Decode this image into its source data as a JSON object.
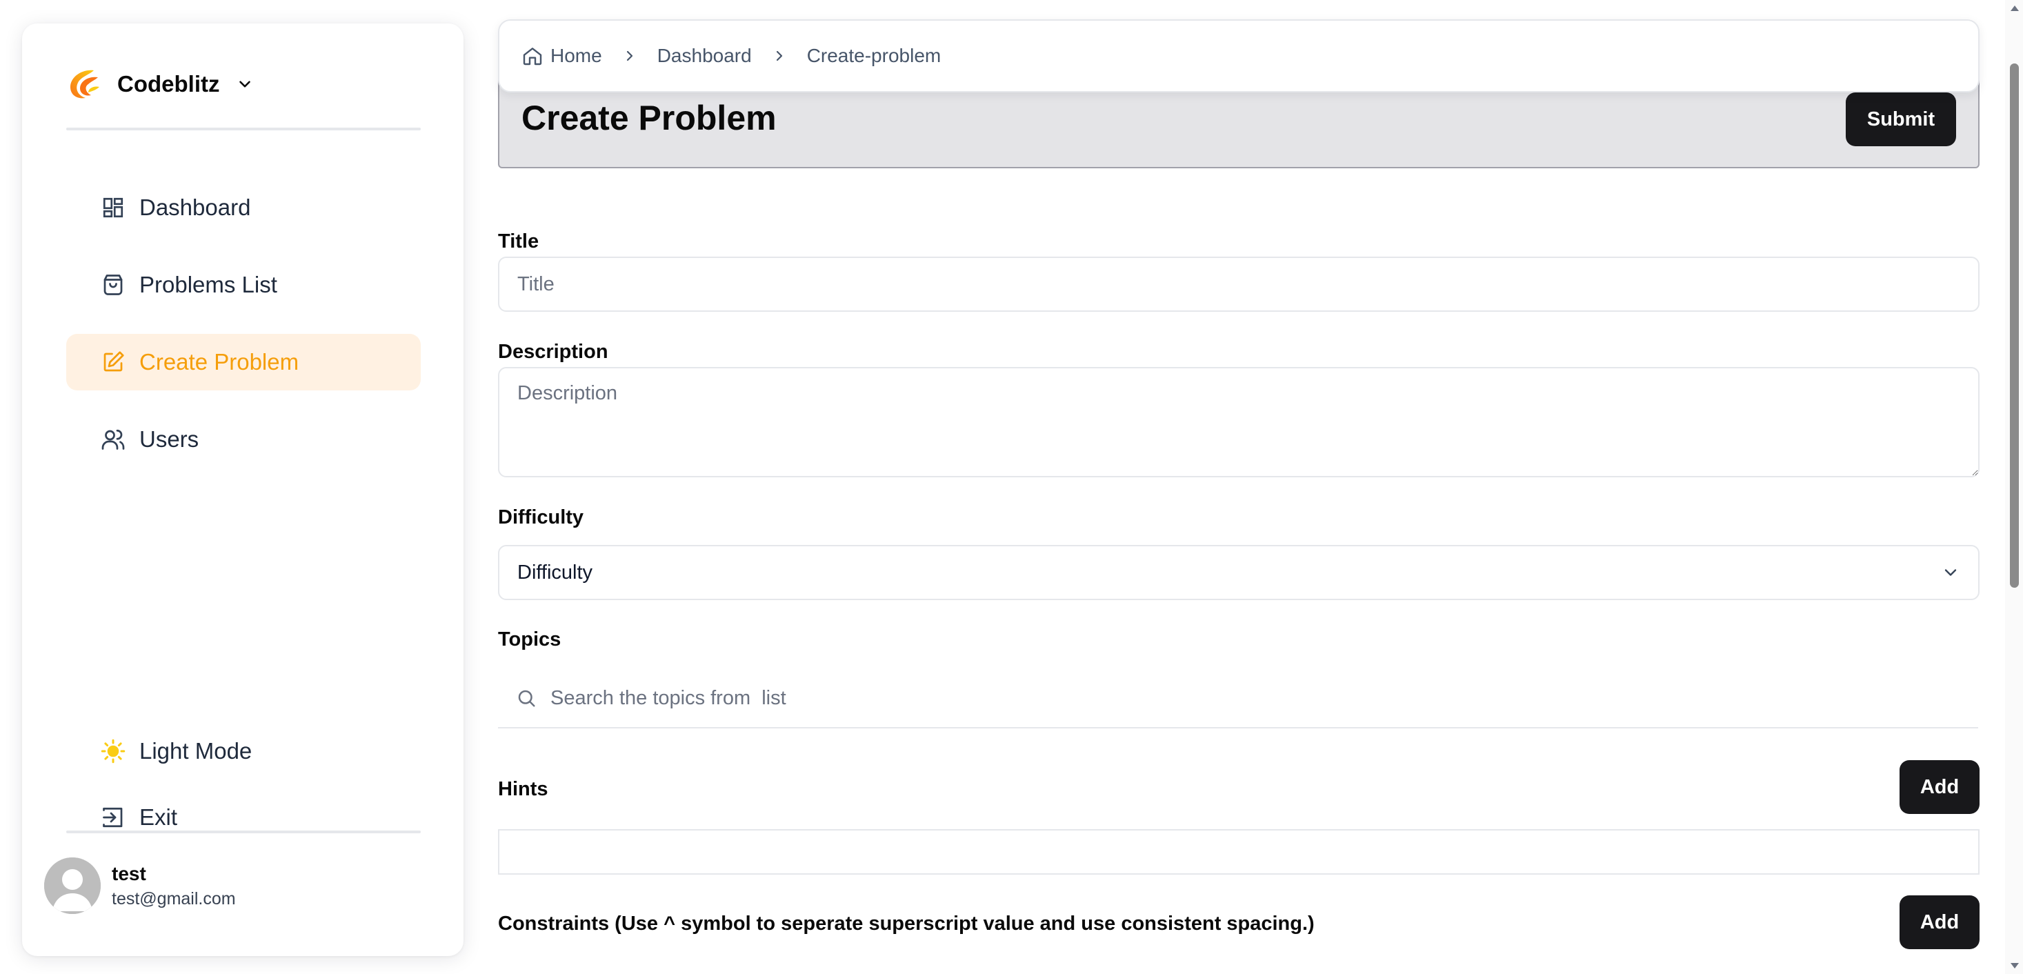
{
  "brand": {
    "name": "Codeblitz",
    "logo_colors": [
      "#f97316",
      "#facc15"
    ]
  },
  "sidebar": {
    "items": [
      {
        "label": "Dashboard",
        "icon": "dashboard-icon"
      },
      {
        "label": "Problems List",
        "icon": "shopping-bag-icon"
      },
      {
        "label": "Create Problem",
        "icon": "edit-square-icon",
        "active": true
      },
      {
        "label": "Users",
        "icon": "users-icon"
      }
    ],
    "theme_toggle": {
      "label": "Light Mode",
      "icon": "sun-icon"
    },
    "exit": {
      "label": "Exit",
      "icon": "log-out-icon"
    },
    "user": {
      "name": "test",
      "email": "test@gmail.com"
    }
  },
  "breadcrumb": {
    "home": "Home",
    "dashboard": "Dashboard",
    "current": "Create-problem"
  },
  "header": {
    "title": "Create Problem",
    "submit_label": "Submit"
  },
  "form": {
    "title_label": "Title",
    "title_placeholder": "Title",
    "description_label": "Description",
    "description_placeholder": "Description",
    "difficulty_label": "Difficulty",
    "difficulty_value": "Difficulty",
    "topics_label": "Topics",
    "topics_placeholder": "Search the topics from  list",
    "hints_label": "Hints",
    "hints_add_label": "Add",
    "constraints_label": "Constraints (Use ^ symbol to seperate superscript value and use consistent spacing.)",
    "constraints_add_label": "Add"
  },
  "colors": {
    "accent": "#f59e0b",
    "active_bg": "#fff1e2",
    "dark_button": "#18181b",
    "header_bg": "#e4e4e7"
  }
}
